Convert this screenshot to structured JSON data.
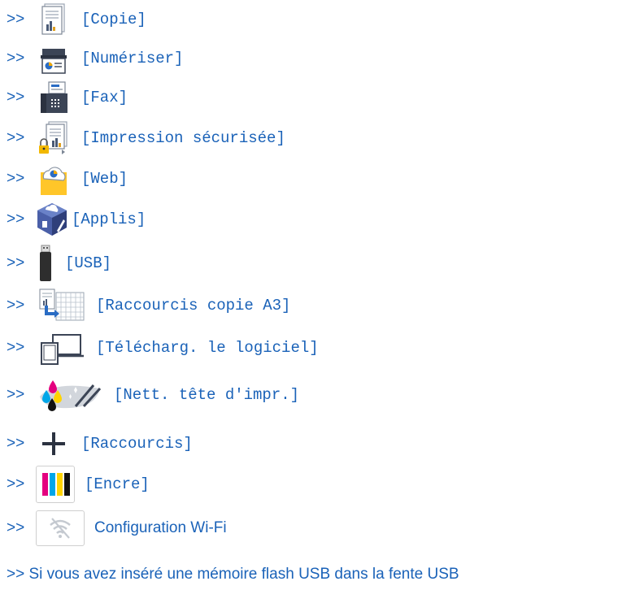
{
  "items": [
    {
      "arrow": ">>",
      "label": "[Copie]",
      "icon": "copy-icon"
    },
    {
      "arrow": ">>",
      "label": "[Numériser]",
      "icon": "scan-icon"
    },
    {
      "arrow": ">>",
      "label": "[Fax]",
      "icon": "fax-icon"
    },
    {
      "arrow": ">>",
      "label": "[Impression sécurisée]",
      "icon": "secure-print-icon"
    },
    {
      "arrow": ">>",
      "label": "[Web]",
      "icon": "web-icon"
    },
    {
      "arrow": ">>",
      "label": "[Applis]",
      "icon": "apps-icon"
    },
    {
      "arrow": ">>",
      "label": "[USB]",
      "icon": "usb-icon"
    },
    {
      "arrow": ">>",
      "label": "[Raccourcis copie A3]",
      "icon": "a3-copy-shortcut-icon"
    },
    {
      "arrow": ">>",
      "label": "[Télécharg. le logiciel]",
      "icon": "download-software-icon"
    },
    {
      "arrow": ">>",
      "label": "[Nett. tête d'impr.]",
      "icon": "print-head-cleaning-icon"
    },
    {
      "arrow": ">>",
      "label": "[Raccourcis]",
      "icon": "shortcuts-plus-icon"
    },
    {
      "arrow": ">>",
      "label": "[Encre]",
      "icon": "ink-icon"
    },
    {
      "arrow": ">>",
      "label": "Configuration Wi-Fi",
      "icon": "wifi-off-icon"
    }
  ],
  "last_line": ">> Si vous avez inséré une mémoire flash USB dans la fente USB",
  "colors": {
    "link": "#1a62b8",
    "ink_cyan": "#00a6e8",
    "ink_magenta": "#e4007f",
    "ink_yellow": "#ffd400",
    "ink_black": "#111111"
  }
}
